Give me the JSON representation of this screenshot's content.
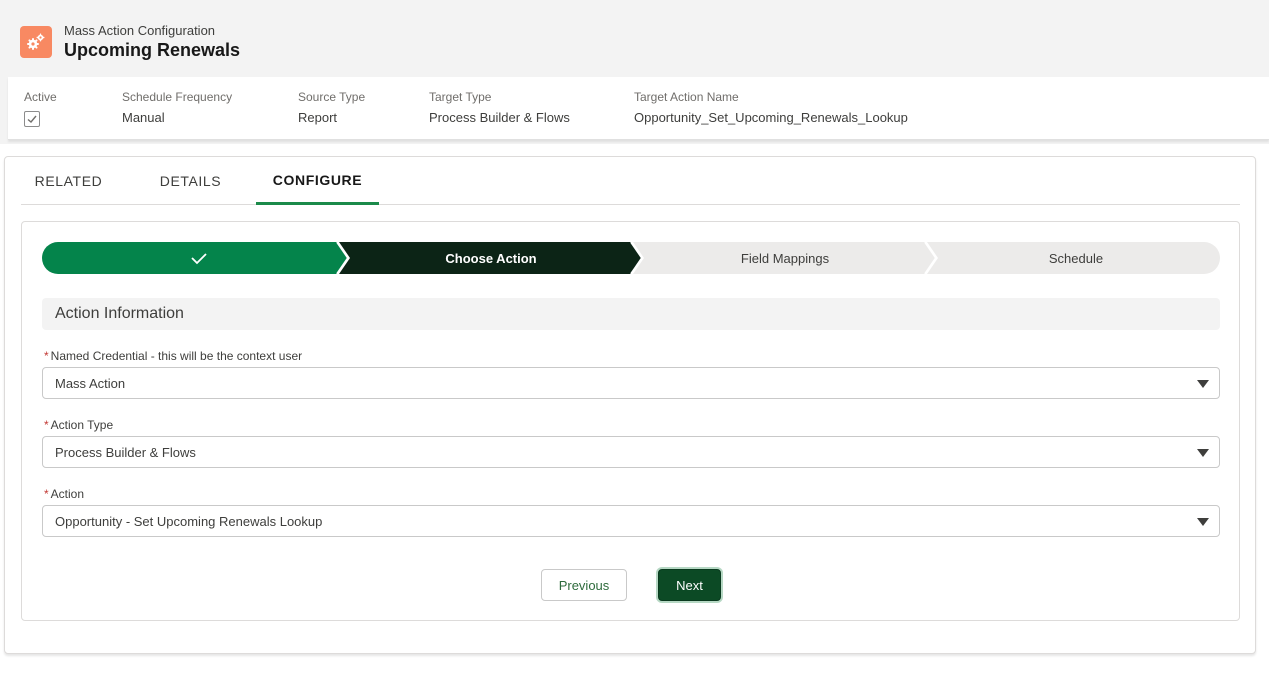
{
  "header": {
    "object_label": "Mass Action Configuration",
    "record_name": "Upcoming Renewals",
    "icon": "gears-icon",
    "icon_color": "#f88962"
  },
  "highlights": [
    {
      "label": "Active",
      "value": "",
      "checked": true
    },
    {
      "label": "Schedule Frequency",
      "value": "Manual"
    },
    {
      "label": "Source Type",
      "value": "Report"
    },
    {
      "label": "Target Type",
      "value": "Process Builder & Flows"
    },
    {
      "label": "Target Action Name",
      "value": "Opportunity_Set_Upcoming_Renewals_Lookup"
    }
  ],
  "tabs": [
    {
      "label": "RELATED",
      "active": false
    },
    {
      "label": "DETAILS",
      "active": false
    },
    {
      "label": "CONFIGURE",
      "active": true
    }
  ],
  "path": {
    "steps": [
      {
        "label": "",
        "state": "complete",
        "icon": "check-icon"
      },
      {
        "label": "Choose Action",
        "state": "current"
      },
      {
        "label": "Field Mappings",
        "state": "incomplete"
      },
      {
        "label": "Schedule",
        "state": "incomplete"
      }
    ],
    "colors": {
      "complete": "#04844b",
      "current": "#0c2416",
      "incomplete": "#ecebea"
    }
  },
  "section": {
    "title": "Action Information"
  },
  "form": {
    "named_credential": {
      "label": "Named Credential - this will be the context user",
      "value": "Mass Action",
      "required": "*"
    },
    "action_type": {
      "label": "Action Type",
      "value": "Process Builder & Flows",
      "required": "*"
    },
    "action": {
      "label": "Action",
      "value": "Opportunity - Set Upcoming Renewals Lookup",
      "required": "*"
    }
  },
  "buttons": {
    "previous": "Previous",
    "next": "Next"
  }
}
